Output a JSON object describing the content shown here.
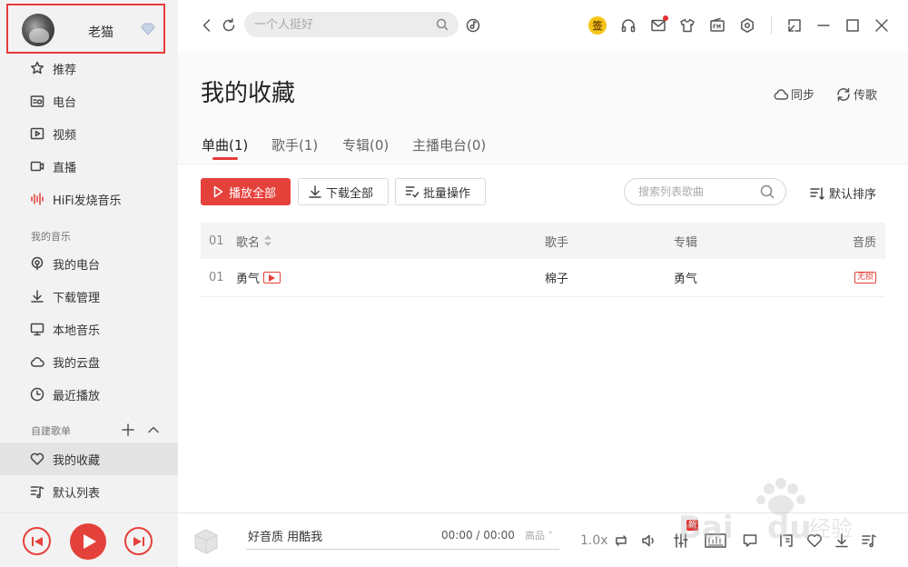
{
  "user": {
    "name": "老猫"
  },
  "sidebar": {
    "items": [
      {
        "label": "推荐",
        "icon": "star-icon"
      },
      {
        "label": "电台",
        "icon": "radio-icon"
      },
      {
        "label": "视频",
        "icon": "video-icon"
      },
      {
        "label": "直播",
        "icon": "live-icon"
      },
      {
        "label": "HiFi发烧音乐",
        "icon": "hifi-wave-icon"
      }
    ],
    "my_music_title": "我的音乐",
    "my_music": [
      {
        "label": "我的电台",
        "icon": "podcast-icon"
      },
      {
        "label": "下载管理",
        "icon": "download-icon"
      },
      {
        "label": "本地音乐",
        "icon": "monitor-icon"
      },
      {
        "label": "我的云盘",
        "icon": "cloud-icon"
      },
      {
        "label": "最近播放",
        "icon": "clock-icon"
      }
    ],
    "playlists_title": "自建歌单",
    "playlists": [
      {
        "label": "我的收藏",
        "icon": "heart-icon",
        "active": true
      },
      {
        "label": "默认列表",
        "icon": "music-list-icon"
      }
    ]
  },
  "topbar": {
    "search_placeholder": "一个人挺好",
    "sign_label": "签"
  },
  "main": {
    "title": "我的收藏",
    "sync_label": "同步",
    "transfer_label": "传歌",
    "tabs": [
      "单曲(1)",
      "歌手(1)",
      "专辑(0)",
      "主播电台(0)"
    ],
    "active_tab": 0,
    "toolbar": {
      "play_all": "播放全部",
      "download_all": "下载全部",
      "batch": "批量操作",
      "search_placeholder": "搜索列表歌曲",
      "sort": "默认排序"
    },
    "table": {
      "headers": {
        "index": "01",
        "name": "歌名",
        "artist": "歌手",
        "album": "专辑",
        "quality": "音质"
      },
      "rows": [
        {
          "index": "01",
          "name": "勇气",
          "artist": "棉子",
          "album": "勇气",
          "quality": "无损"
        }
      ]
    }
  },
  "player": {
    "track": "好音质 用酷我",
    "time": "00:00 / 00:00",
    "quality": "高品 ˄",
    "speed": "1.0x",
    "new_badge": "新"
  },
  "colors": {
    "accent": "#e5413b",
    "sidebar_bg": "#f3f2f2",
    "highlight_border": "#e63b3b"
  }
}
